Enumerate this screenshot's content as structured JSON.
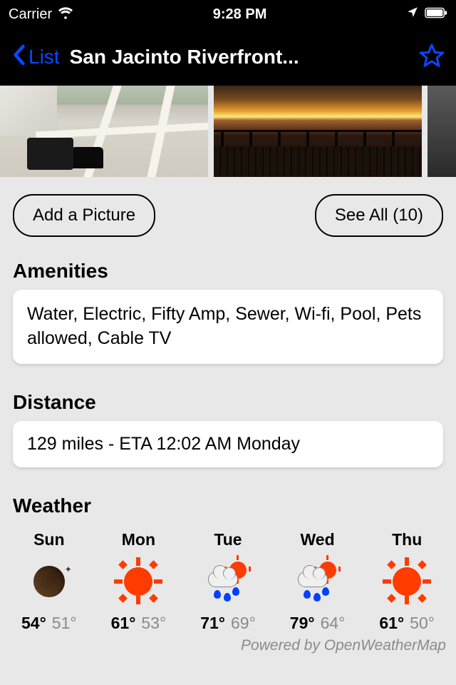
{
  "status": {
    "carrier": "Carrier",
    "time": "9:28 PM"
  },
  "nav": {
    "back_label": "List",
    "title": "San Jacinto Riverfront..."
  },
  "photos": {
    "add_label": "Add a Picture",
    "see_all_label": "See All (10)"
  },
  "amenities": {
    "header": "Amenities",
    "text": "Water, Electric, Fifty Amp, Sewer, Wi-fi, Pool, Pets allowed, Cable TV"
  },
  "distance": {
    "header": "Distance",
    "text": "129 miles - ETA 12:02 AM Monday"
  },
  "weather": {
    "header": "Weather",
    "attribution": "Powered by OpenWeatherMap",
    "days": [
      {
        "label": "Sun",
        "icon": "moon",
        "hi": "54°",
        "lo": "51°"
      },
      {
        "label": "Mon",
        "icon": "sun",
        "hi": "61°",
        "lo": "53°"
      },
      {
        "label": "Tue",
        "icon": "rain",
        "hi": "71°",
        "lo": "69°"
      },
      {
        "label": "Wed",
        "icon": "rain",
        "hi": "79°",
        "lo": "64°"
      },
      {
        "label": "Thu",
        "icon": "sun",
        "hi": "61°",
        "lo": "50°"
      }
    ]
  }
}
